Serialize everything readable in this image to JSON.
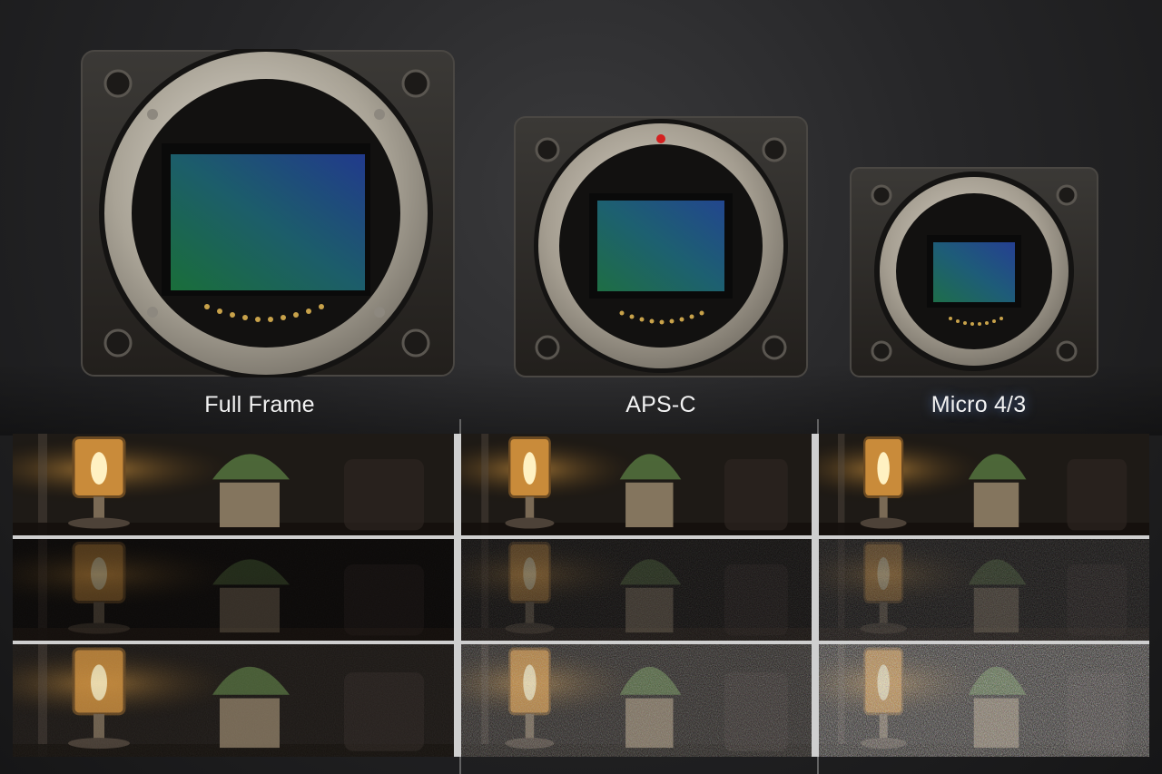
{
  "labels": {
    "full_frame": "Full Frame",
    "aps_c": "APS-C",
    "micro_43": "Micro 4/3"
  },
  "scene": {
    "rows": [
      "normal",
      "underexposed",
      "pushed-noise"
    ],
    "noise_levels": [
      0.0,
      0.35,
      0.7
    ],
    "colors": {
      "lamp_glow": "#ffb347",
      "sensor_green": "#1f6b4a",
      "sensor_blue": "#1c3f8a",
      "mount_silver": "#b9b4ab",
      "body_dark": "#2b2926"
    }
  }
}
